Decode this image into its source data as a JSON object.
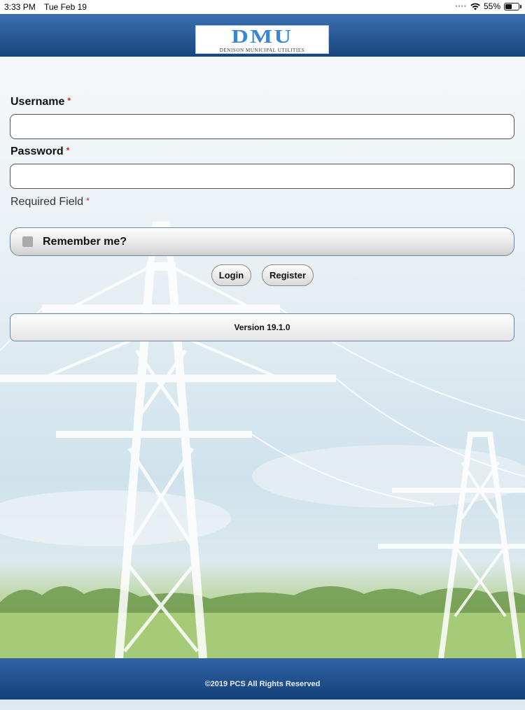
{
  "status_bar": {
    "time": "3:33 PM",
    "date": "Tue Feb 19",
    "battery": "55%",
    "battery_level": 0.55
  },
  "header": {
    "logo_mark": "DMU",
    "logo_subtitle": "DENISON MUNICIPAL UTILITIES"
  },
  "form": {
    "username_label": "Username",
    "password_label": "Password",
    "required_marker": "*",
    "username_value": "",
    "password_value": "",
    "required_field_text": "Required Field",
    "remember_label": "Remember me?",
    "remember_checked": false,
    "login_label": "Login",
    "register_label": "Register",
    "version_text": "Version 19.1.0"
  },
  "footer": {
    "copyright": "©2019 PCS All Rights Reserved"
  },
  "colors": {
    "header_blue": "#1f5596",
    "required_red": "#d01f1f",
    "logo_blue": "#3b86d4"
  }
}
